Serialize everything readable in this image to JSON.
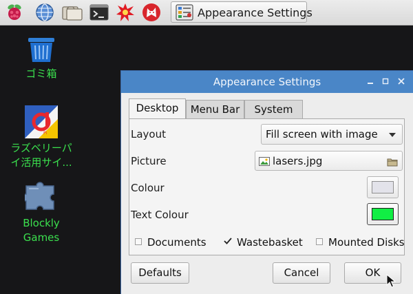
{
  "taskbar": {
    "launchers": [
      {
        "icon": "raspberry-icon"
      },
      {
        "icon": "globe-icon"
      },
      {
        "icon": "folder-icon"
      },
      {
        "icon": "terminal-icon"
      },
      {
        "icon": "starburst-icon"
      },
      {
        "icon": "wolfram-wolf-icon"
      }
    ],
    "task_button_label": "Appearance Settings"
  },
  "desktop": {
    "icons": [
      {
        "icon": "trash-icon",
        "label": "ゴミ箱"
      },
      {
        "icon": "raspi-site-icon",
        "label_line1": "ラズベリーパ",
        "label_line2": "イ活用サイ..."
      },
      {
        "icon": "puzzle-icon",
        "label_line1": "Blockly",
        "label_line2": "Games"
      }
    ]
  },
  "window": {
    "title": "Appearance Settings",
    "tabs": [
      {
        "label": "Desktop",
        "active": true
      },
      {
        "label": "Menu Bar",
        "active": false
      },
      {
        "label": "System",
        "active": false
      }
    ],
    "layout": {
      "label": "Layout",
      "value": "Fill screen with image"
    },
    "picture": {
      "label": "Picture",
      "value": "lasers.jpg"
    },
    "colour": {
      "label": "Colour",
      "swatch": "#e3e3ea"
    },
    "text_colour": {
      "label": "Text Colour",
      "swatch": "#11ee44"
    },
    "checkboxes": [
      {
        "label": "Documents",
        "checked": false
      },
      {
        "label": "Wastebasket",
        "checked": true
      },
      {
        "label": "Mounted Disks",
        "checked": false
      }
    ],
    "buttons": {
      "defaults": "Defaults",
      "cancel": "Cancel",
      "ok": "OK"
    }
  },
  "colors": {
    "titlebar": "#4a86c7",
    "desktop_label": "#3be04e",
    "background": "#161618"
  }
}
